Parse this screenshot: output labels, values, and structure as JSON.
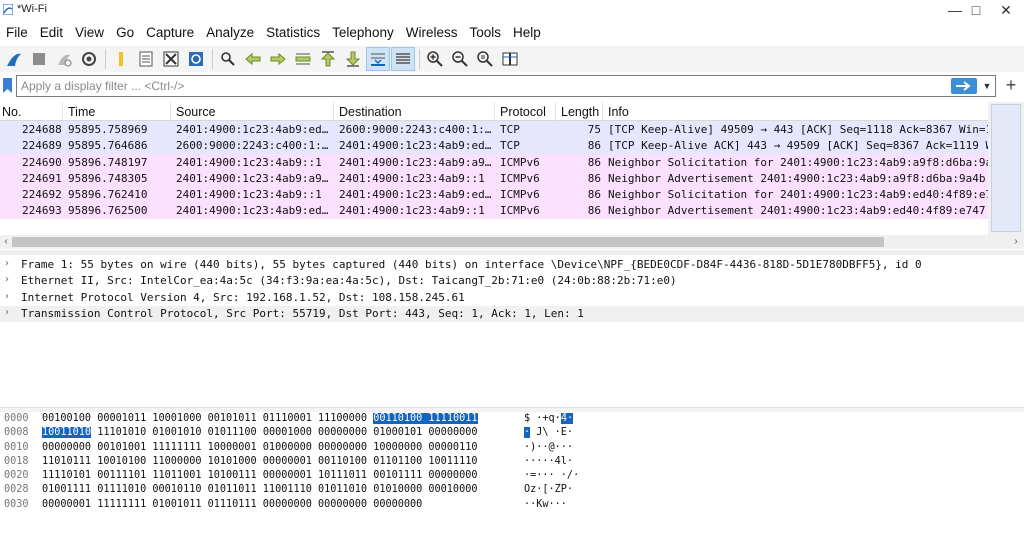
{
  "window": {
    "title": "*Wi-Fi"
  },
  "menu": [
    "File",
    "Edit",
    "View",
    "Go",
    "Capture",
    "Analyze",
    "Statistics",
    "Telephony",
    "Wireless",
    "Tools",
    "Help"
  ],
  "toolbar": {
    "icons": [
      "shark-fin-start-icon",
      "stop-square-icon",
      "restart-capture-icon",
      "capture-options-icon",
      "open-folder-icon",
      "save-file-icon",
      "close-file-icon",
      "reload-file-icon",
      "find-packet-icon",
      "go-back-icon",
      "go-forward-icon",
      "go-to-packet-icon",
      "go-first-icon",
      "go-last-icon",
      "autoscroll-icon",
      "colorize-icon",
      "zoom-in-icon",
      "zoom-out-icon",
      "zoom-normal-icon",
      "resize-columns-icon"
    ]
  },
  "filter": {
    "placeholder": "Apply a display filter ... <Ctrl-/>"
  },
  "packet_list": {
    "columns": [
      "No.",
      "Time",
      "Source",
      "Destination",
      "Protocol",
      "Length",
      "Info"
    ],
    "rows": [
      {
        "no": "224688",
        "time": "95895.758969",
        "source": "2401:4900:1c23:4ab9:ed…",
        "destination": "2600:9000:2243:c400:1:…",
        "protocol": "TCP",
        "length": "75",
        "info": "[TCP Keep-Alive] 49509 → 443 [ACK] Seq=1118 Ack=8367 Win=1",
        "color": "#e7e6ff"
      },
      {
        "no": "224689",
        "time": "95895.764686",
        "source": "2600:9000:2243:c400:1:…",
        "destination": "2401:4900:1c23:4ab9:ed…",
        "protocol": "TCP",
        "length": "86",
        "info": "[TCP Keep-Alive ACK] 443 → 49509 [ACK] Seq=8367 Ack=1119 W",
        "color": "#e7e6ff"
      },
      {
        "no": "224690",
        "time": "95896.748197",
        "source": "2401:4900:1c23:4ab9::1",
        "destination": "2401:4900:1c23:4ab9:a9…",
        "protocol": "ICMPv6",
        "length": "86",
        "info": "Neighbor Solicitation for 2401:4900:1c23:4ab9:a9f8:d6ba:9a",
        "color": "#fce0ff"
      },
      {
        "no": "224691",
        "time": "95896.748305",
        "source": "2401:4900:1c23:4ab9:a9…",
        "destination": "2401:4900:1c23:4ab9::1",
        "protocol": "ICMPv6",
        "length": "86",
        "info": "Neighbor Advertisement 2401:4900:1c23:4ab9:a9f8:d6ba:9a4b:",
        "color": "#fce0ff"
      },
      {
        "no": "224692",
        "time": "95896.762410",
        "source": "2401:4900:1c23:4ab9::1",
        "destination": "2401:4900:1c23:4ab9:ed…",
        "protocol": "ICMPv6",
        "length": "86",
        "info": "Neighbor Solicitation for 2401:4900:1c23:4ab9:ed40:4f89:e7",
        "color": "#fce0ff"
      },
      {
        "no": "224693",
        "time": "95896.762500",
        "source": "2401:4900:1c23:4ab9:ed…",
        "destination": "2401:4900:1c23:4ab9::1",
        "protocol": "ICMPv6",
        "length": "86",
        "info": "Neighbor Advertisement 2401:4900:1c23:4ab9:ed40:4f89:e747:",
        "color": "#fce0ff"
      }
    ]
  },
  "details": [
    "Frame 1: 55 bytes on wire (440 bits), 55 bytes captured (440 bits) on interface \\Device\\NPF_{BEDE0CDF-D84F-4436-818D-5D1E780DBFF5}, id 0",
    "Ethernet II, Src: IntelCor_ea:4a:5c (34:f3:9a:ea:4a:5c), Dst: TaicangT_2b:71:e0 (24:0b:88:2b:71:e0)",
    "Internet Protocol Version 4, Src: 192.168.1.52, Dst: 108.158.245.61",
    "Transmission Control Protocol, Src Port: 55719, Dst Port: 443, Seq: 1, Ack: 1, Len: 1"
  ],
  "bytes": [
    {
      "offset": "0000",
      "pre": "00100100 00001011 10001000 00101011 01110001 11100000 ",
      "hl": "00110100 11110011",
      "post": "",
      "a_pre": "$ ·+q·",
      "a_hl": "4·",
      "a_post": ""
    },
    {
      "offset": "0008",
      "pre": "",
      "hl": "10011010",
      "post": " 11101010 01001010 01011100 00001000 00000000 01000101 00000000",
      "a_pre": "",
      "a_hl": "·",
      "a_post": " J\\ ·E·"
    },
    {
      "offset": "0010",
      "pre": "00000000 00101001 11111111 10000001 01000000 00000000 10000000 00000110",
      "hl": "",
      "post": "",
      "a_pre": "·)··@···",
      "a_hl": "",
      "a_post": ""
    },
    {
      "offset": "0018",
      "pre": "11010111 10010100 11000000 10101000 00000001 00110100 01101100 10011110",
      "hl": "",
      "post": "",
      "a_pre": "·····4l·",
      "a_hl": "",
      "a_post": ""
    },
    {
      "offset": "0020",
      "pre": "11110101 00111101 11011001 10100111 00000001 10111011 00101111 00000000",
      "hl": "",
      "post": "",
      "a_pre": "·=··· ·/·",
      "a_hl": "",
      "a_post": ""
    },
    {
      "offset": "0028",
      "pre": "01001111 01111010 00010110 01011011 11001110 01011010 01010000 00010000",
      "hl": "",
      "post": "",
      "a_pre": "Oz·[·ZP·",
      "a_hl": "",
      "a_post": ""
    },
    {
      "offset": "0030",
      "pre": "00000001 11111111 01001011 01110111 00000000 00000000 00000000",
      "hl": "",
      "post": "",
      "a_pre": "··Kw···",
      "a_hl": "",
      "a_post": ""
    }
  ]
}
